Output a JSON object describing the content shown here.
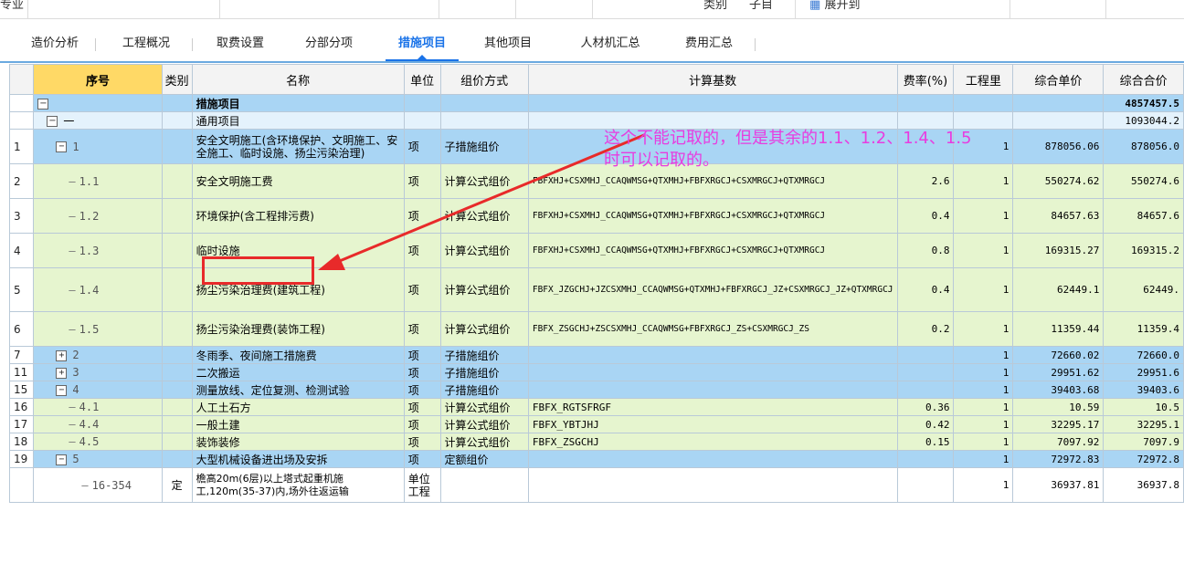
{
  "topbar": {
    "frag_left": "专业",
    "frag_type": "类别",
    "frag_sub": "子目",
    "frag_expand": "展开到"
  },
  "tabs": [
    {
      "label": "造价分析",
      "active": false
    },
    {
      "label": "工程概况",
      "active": false
    },
    {
      "label": "取费设置",
      "active": false
    },
    {
      "label": "分部分项",
      "active": false
    },
    {
      "label": "措施项目",
      "active": true
    },
    {
      "label": "其他项目",
      "active": false
    },
    {
      "label": "人材机汇总",
      "active": false
    },
    {
      "label": "费用汇总",
      "active": false
    }
  ],
  "headers": [
    "序号",
    "类别",
    "名称",
    "单位",
    "组价方式",
    "计算基数",
    "费率(%)",
    "工程里",
    "综合单价",
    "综合合价"
  ],
  "rows": [
    {
      "rn": "",
      "seq": "",
      "cat": "",
      "name": "措施项目",
      "unit": "",
      "method": "",
      "base": "",
      "rate": "",
      "qty": "",
      "price": "",
      "total": "4857457.5"
    },
    {
      "rn": "",
      "seq": "一",
      "cat": "",
      "name": "通用项目",
      "unit": "",
      "method": "",
      "base": "",
      "rate": "",
      "qty": "",
      "price": "",
      "total": "1093044.2"
    },
    {
      "rn": "1",
      "seq": "1",
      "cat": "",
      "name": "安全文明施工(含环境保护、文明施工、安全施工、临时设施、扬尘污染治理)",
      "unit": "项",
      "method": "子措施组价",
      "base": "",
      "rate": "",
      "qty": "1",
      "price": "878056.06",
      "total": "878056.0"
    },
    {
      "rn": "2",
      "seq": "1.1",
      "cat": "",
      "name": "安全文明施工费",
      "unit": "项",
      "method": "计算公式组价",
      "base": "FBFXHJ+CSXMHJ_CCAQWMSG+QTXMHJ+FBFXRGCJ+CSXMRGCJ+QTXMRGCJ",
      "rate": "2.6",
      "qty": "1",
      "price": "550274.62",
      "total": "550274.6"
    },
    {
      "rn": "3",
      "seq": "1.2",
      "cat": "",
      "name": "环境保护(含工程排污费)",
      "unit": "项",
      "method": "计算公式组价",
      "base": "FBFXHJ+CSXMHJ_CCAQWMSG+QTXMHJ+FBFXRGCJ+CSXMRGCJ+QTXMRGCJ",
      "rate": "0.4",
      "qty": "1",
      "price": "84657.63",
      "total": "84657.6"
    },
    {
      "rn": "4",
      "seq": "1.3",
      "cat": "",
      "name": "临时设施",
      "unit": "项",
      "method": "计算公式组价",
      "base": "FBFXHJ+CSXMHJ_CCAQWMSG+QTXMHJ+FBFXRGCJ+CSXMRGCJ+QTXMRGCJ",
      "rate": "0.8",
      "qty": "1",
      "price": "169315.27",
      "total": "169315.2"
    },
    {
      "rn": "5",
      "seq": "1.4",
      "cat": "",
      "name": "扬尘污染治理费(建筑工程)",
      "unit": "项",
      "method": "计算公式组价",
      "base": "FBFX_JZGCHJ+JZCSXMHJ_CCAQWMSG+QTXMHJ+FBFXRGCJ_JZ+CSXMRGCJ_JZ+QTXMRGCJ",
      "rate": "0.4",
      "qty": "1",
      "price": "62449.1",
      "total": "62449."
    },
    {
      "rn": "6",
      "seq": "1.5",
      "cat": "",
      "name": "扬尘污染治理费(装饰工程)",
      "unit": "项",
      "method": "计算公式组价",
      "base": "FBFX_ZSGCHJ+ZSCSXMHJ_CCAQWMSG+FBFXRGCJ_ZS+CSXMRGCJ_ZS",
      "rate": "0.2",
      "qty": "1",
      "price": "11359.44",
      "total": "11359.4"
    },
    {
      "rn": "7",
      "seq": "2",
      "cat": "",
      "name": "冬雨季、夜间施工措施费",
      "unit": "项",
      "method": "子措施组价",
      "base": "",
      "rate": "",
      "qty": "1",
      "price": "72660.02",
      "total": "72660.0"
    },
    {
      "rn": "11",
      "seq": "3",
      "cat": "",
      "name": "二次搬运",
      "unit": "项",
      "method": "子措施组价",
      "base": "",
      "rate": "",
      "qty": "1",
      "price": "29951.62",
      "total": "29951.6"
    },
    {
      "rn": "15",
      "seq": "4",
      "cat": "",
      "name": "测量放线、定位复测、检测试验",
      "unit": "项",
      "method": "子措施组价",
      "base": "",
      "rate": "",
      "qty": "1",
      "price": "39403.68",
      "total": "39403.6"
    },
    {
      "rn": "16",
      "seq": "4.1",
      "cat": "",
      "name": "人工土石方",
      "unit": "项",
      "method": "计算公式组价",
      "base": "FBFX_RGTSFRGF",
      "rate": "0.36",
      "qty": "1",
      "price": "10.59",
      "total": "10.5"
    },
    {
      "rn": "17",
      "seq": "4.4",
      "cat": "",
      "name": "一般土建",
      "unit": "项",
      "method": "计算公式组价",
      "base": "FBFX_YBTJHJ",
      "rate": "0.42",
      "qty": "1",
      "price": "32295.17",
      "total": "32295.1"
    },
    {
      "rn": "18",
      "seq": "4.5",
      "cat": "",
      "name": "装饰装修",
      "unit": "项",
      "method": "计算公式组价",
      "base": "FBFX_ZSGCHJ",
      "rate": "0.15",
      "qty": "1",
      "price": "7097.92",
      "total": "7097.9"
    },
    {
      "rn": "19",
      "seq": "5",
      "cat": "",
      "name": "大型机械设备进出场及安拆",
      "unit": "项",
      "method": "定额组价",
      "base": "",
      "rate": "",
      "qty": "1",
      "price": "72972.83",
      "total": "72972.8"
    },
    {
      "rn": "",
      "seq": "16-354",
      "cat": "定",
      "name": "檐高20m(6层)以上塔式起重机施工,120m(35-37)内,场外往返运输",
      "unit": "单位工程",
      "method": "",
      "base": "",
      "rate": "",
      "qty": "1",
      "price": "36937.81",
      "total": "36937.8"
    }
  ],
  "tree": {
    "expanded": "−",
    "collapsed": "+",
    "leaf": "—"
  },
  "annotation": {
    "line1": "这个不能记取的，但是其余的1.1、1.2、1.4、1.5",
    "line2": "时可以记取的。"
  },
  "colors": {
    "accent": "#1a73e8",
    "row_blue": "#a9d5f4",
    "row_green": "#e6f5cf",
    "annotation": "#e83ce0",
    "highlight": "#e82a2a"
  }
}
